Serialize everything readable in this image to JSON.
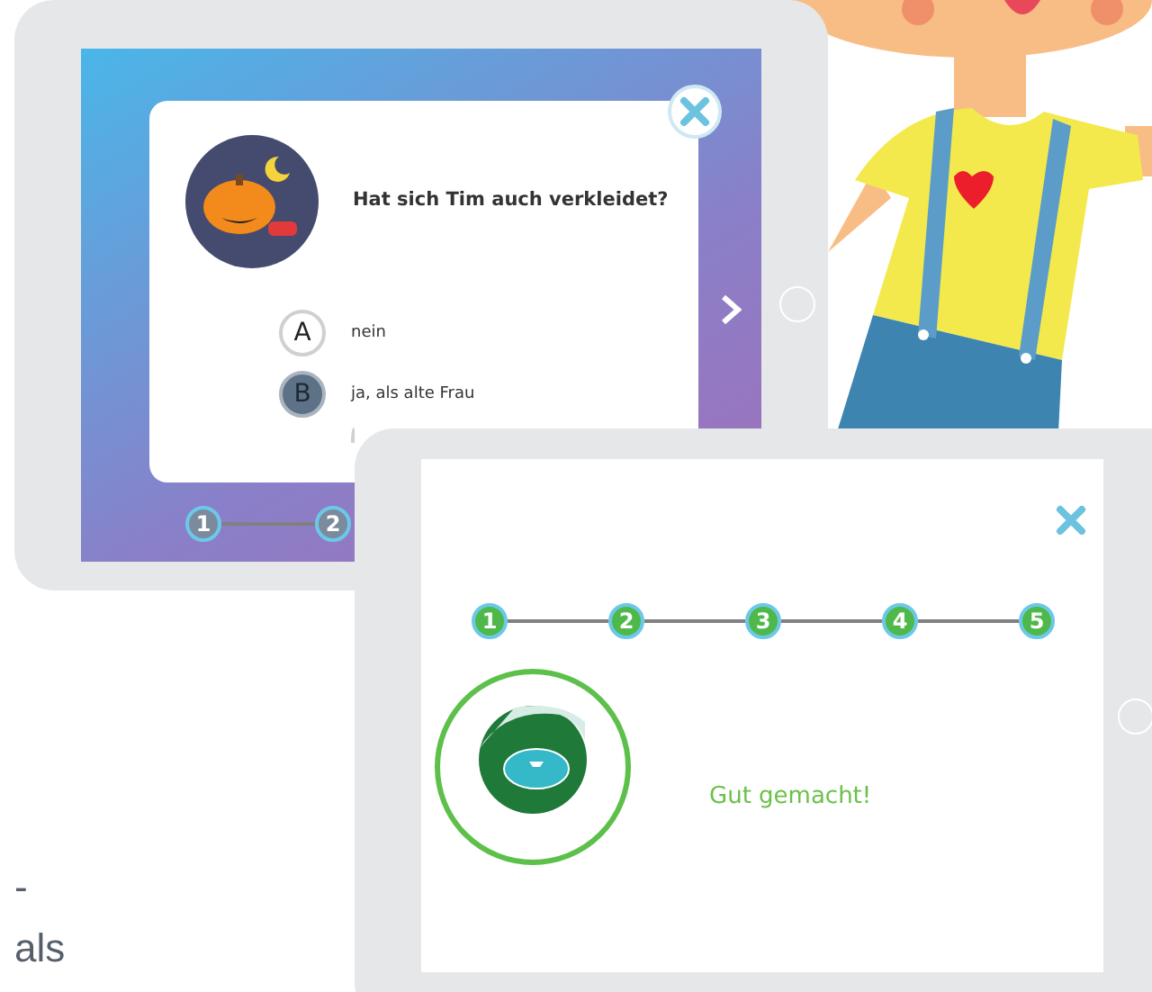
{
  "quiz_tablet": {
    "question": "Hat sich Tim auch verkleidet?",
    "options": [
      {
        "letter": "A",
        "text": "nein",
        "selected": false
      },
      {
        "letter": "B",
        "text": "ja, als alte Frau",
        "selected": true
      }
    ],
    "progress": [
      {
        "label": "1"
      },
      {
        "label": "2"
      }
    ]
  },
  "result_tablet": {
    "steps": [
      {
        "label": "1",
        "done": true
      },
      {
        "label": "2",
        "done": true
      },
      {
        "label": "3",
        "done": true
      },
      {
        "label": "4",
        "done": true
      },
      {
        "label": "5",
        "done": true
      }
    ],
    "message": "Gut gemacht!"
  },
  "side_text": [
    "-",
    "als"
  ]
}
